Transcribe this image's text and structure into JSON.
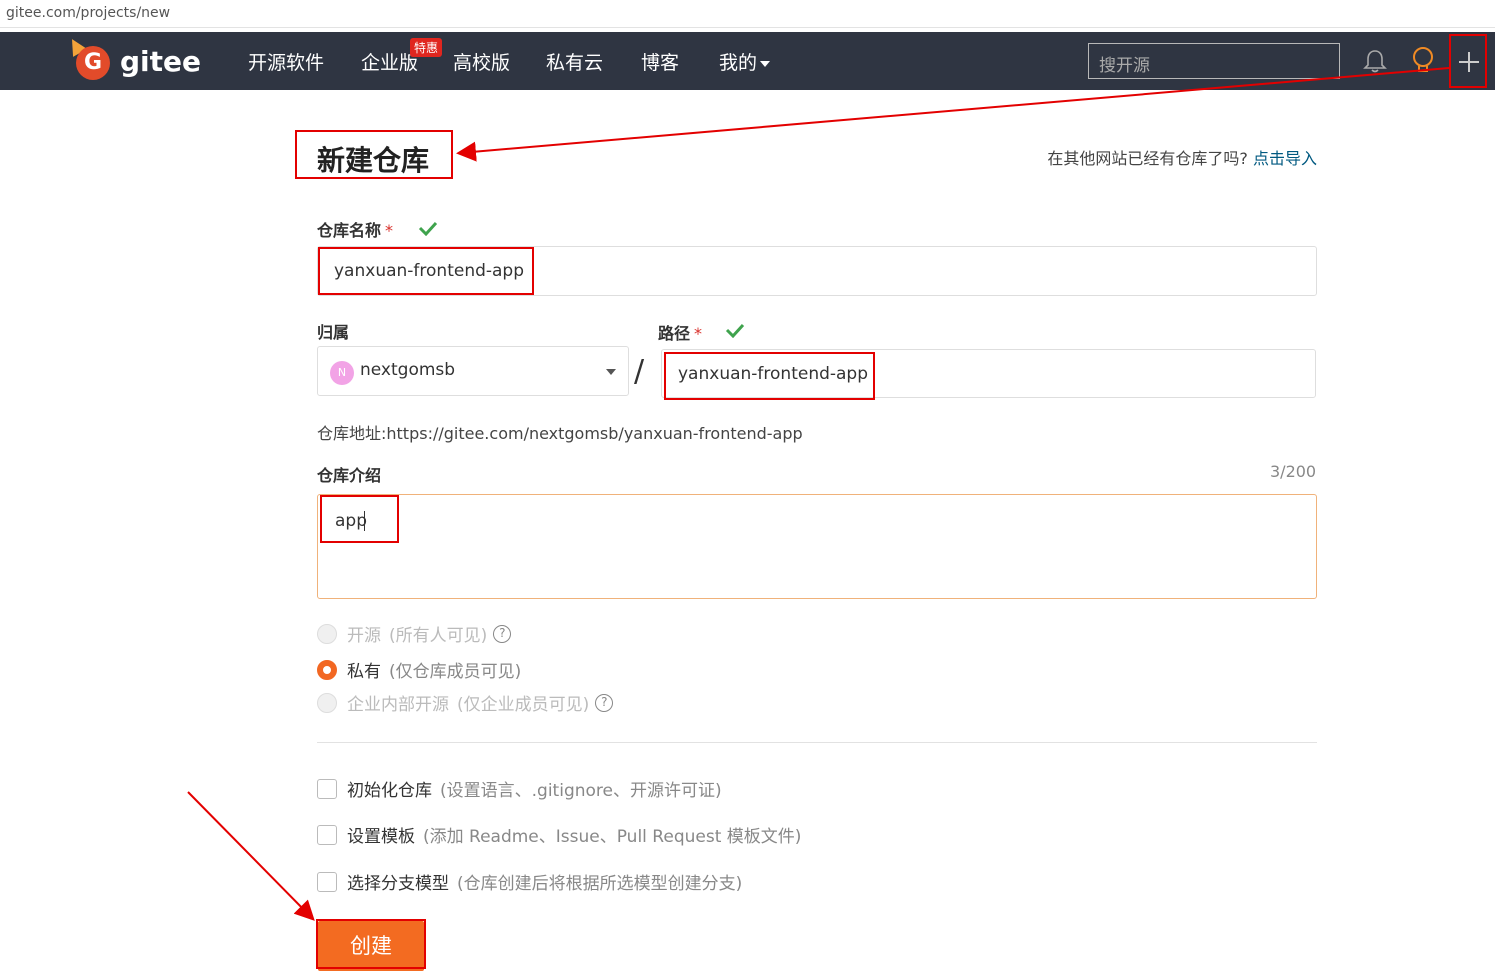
{
  "browser": {
    "url": "gitee.com/projects/new"
  },
  "nav": {
    "brand": "gitee",
    "items": [
      "开源软件",
      "企业版",
      "高校版",
      "私有云",
      "博客",
      "我的"
    ],
    "badge": "特惠",
    "search_placeholder": "搜开源",
    "bg_color": "#2f3542"
  },
  "page": {
    "title": "新建仓库",
    "import_text": "在其他网站已经有仓库了吗?",
    "import_link": "点击导入"
  },
  "form": {
    "repo_name_label": "仓库名称",
    "repo_name_value": "yanxuan-frontend-app",
    "owner_label": "归属",
    "owner_avatar": "N",
    "owner_value": "nextgomsb",
    "path_label": "路径",
    "path_value": "yanxuan-frontend-app",
    "required_mark": "*",
    "separator": "/",
    "repo_url": "仓库地址:https://gitee.com/nextgomsb/yanxuan-frontend-app",
    "desc_label": "仓库介绍",
    "desc_counter": "3/200",
    "desc_value": "app",
    "visibility": [
      {
        "label": "开源",
        "hint": "(所有人可见)",
        "selected": false,
        "disabled": true
      },
      {
        "label": "私有",
        "hint": "(仅仓库成员可见)",
        "selected": true,
        "disabled": false
      },
      {
        "label": "企业内部开源",
        "hint": "(仅企业成员可见)",
        "selected": false,
        "disabled": true
      }
    ],
    "options": [
      {
        "label": "初始化仓库",
        "hint": "(设置语言、.gitignore、开源许可证)"
      },
      {
        "label": "设置模板",
        "hint": "(添加 Readme、Issue、Pull Request 模板文件)"
      },
      {
        "label": "选择分支模型",
        "hint": "(仓库创建后将根据所选模型创建分支)"
      }
    ],
    "submit_label": "创建",
    "accent_color": "#f36b21"
  }
}
